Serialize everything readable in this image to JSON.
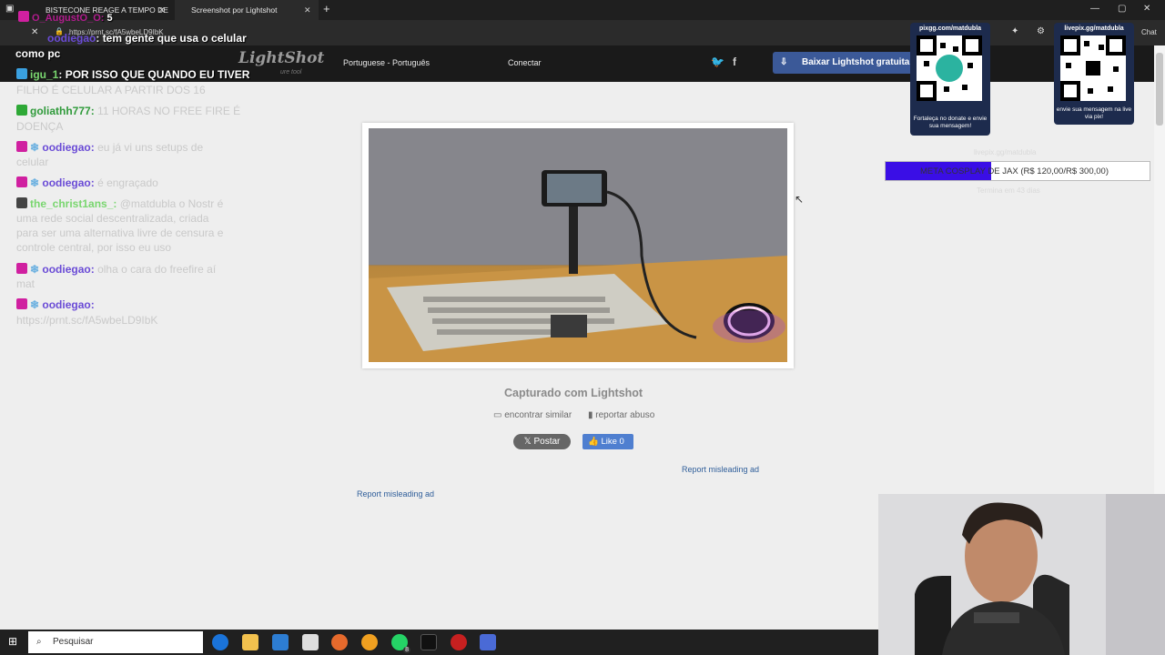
{
  "browser": {
    "tabs": [
      {
        "title": "BISTECONE REAGE A TEMPO DE",
        "active": false
      },
      {
        "title": "Screenshot por Lightshot",
        "active": true
      }
    ],
    "url": "https://prnt.sc/fA5wbeLD9IbK",
    "chat_label": "Chat"
  },
  "lightshot": {
    "logo": "LightShot",
    "logo_sub": "ure tool",
    "language": "Portuguese - Português",
    "connect": "Conectar",
    "download_button": "Baixar Lightshot gratuita",
    "caption": "Capturado com Lightshot",
    "find_similar": "encontrar similar",
    "report_abuse": "reportar abuso",
    "post_button": "Postar",
    "like_button": "Like 0",
    "report_ad_1": "Report misleading ad",
    "report_ad_2": "Report misleading ad"
  },
  "chat": {
    "messages": [
      {
        "user": "O_AugustO_O",
        "text": "5"
      },
      {
        "user": "oodiegao",
        "text": "tem gente que usa o celular"
      },
      {
        "user": "",
        "text": "como pc"
      },
      {
        "user": "igu_1",
        "text": "POR ISSO QUE QUANDO EU TIVER"
      },
      {
        "user": "",
        "text": "FILHO É CELULAR A PARTIR DOS 16"
      },
      {
        "user": "goliathh777",
        "text": "11 HORAS NO FREE FIRE É"
      },
      {
        "user": "",
        "text": "DOENÇA"
      },
      {
        "user": "oodiegao",
        "text": "eu já vi uns setups de"
      },
      {
        "user": "",
        "text": "celular"
      },
      {
        "user": "oodiegao",
        "text": "é engraçado"
      },
      {
        "user": "the_christ1ans_",
        "text": "@matdubla o Nostr é"
      },
      {
        "user": "",
        "text": "uma rede social descentralizada, criada"
      },
      {
        "user": "",
        "text": "para ser uma alternativa livre de censura e"
      },
      {
        "user": "",
        "text": "controle central, por isso eu uso"
      },
      {
        "user": "oodiegao",
        "text": "olha o cara do freefire aí"
      },
      {
        "user": "",
        "text": "mat"
      },
      {
        "user": "oodiegao",
        "text": ""
      },
      {
        "user": "",
        "text": "https://prnt.sc/fA5wbeLD9IbK"
      }
    ]
  },
  "overlays": {
    "qr1_top": "pixgg.com/matdubla",
    "qr1_bottom": "Fortaleça no donate e envie sua mensagem!",
    "qr2_top": "livepix.gg/matdubla",
    "qr2_bottom": "envie sua mensagem na live via pix!",
    "goal_text": "META COSPLAY DE JAX (R$ 120,00/R$ 300,00)",
    "goal_progress": 0.4,
    "goal_top_faded": "livepix.gg/matdubla",
    "goal_bottom_faded": "Termina em 43 dias",
    "goal_color": "#3a0ee6"
  },
  "taskbar": {
    "search_placeholder": "Pesquisar",
    "whatsapp_badge": "8"
  }
}
